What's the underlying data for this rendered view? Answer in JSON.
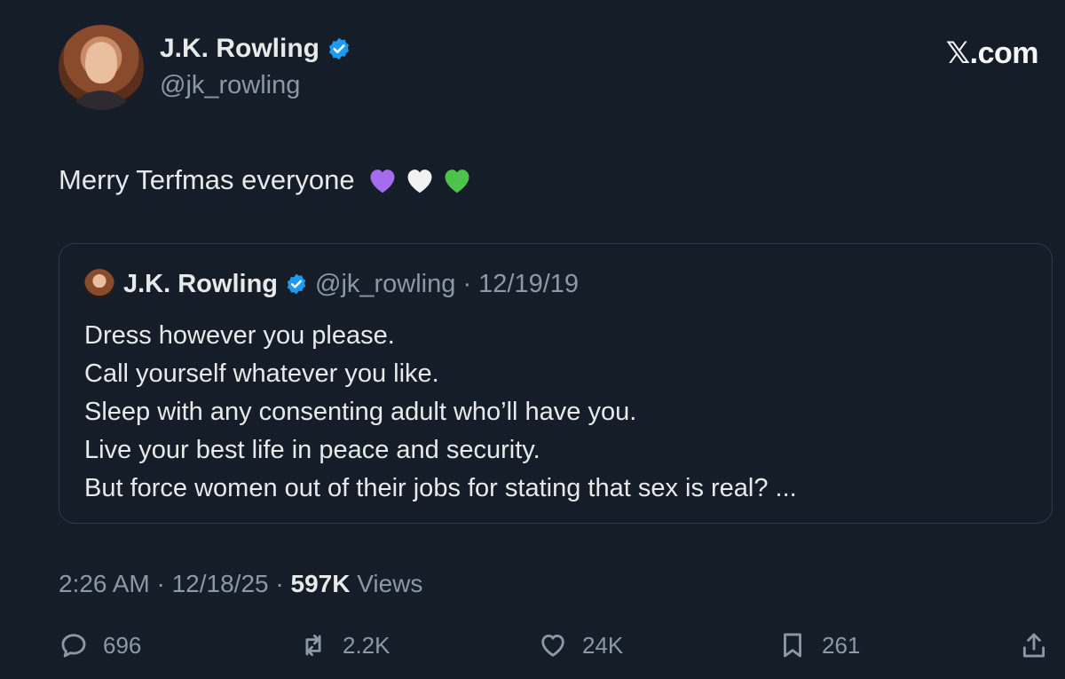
{
  "header": {
    "display_name": "J.K. Rowling",
    "handle": "@jk_rowling",
    "brand": "𝕏.com"
  },
  "tweet": {
    "text": "Merry Terfmas everyone",
    "emojis": [
      "purple-heart",
      "white-heart",
      "green-heart"
    ],
    "timestamp": "2:26 AM · 12/18/25 · ",
    "views_count": "597K",
    "views_label": " Views"
  },
  "quoted": {
    "display_name": "J.K. Rowling",
    "meta": "@jk_rowling · 12/19/19",
    "lines": [
      "Dress however you please.",
      "Call yourself whatever you like.",
      "Sleep with any consenting adult who’ll have you.",
      "Live your best life in peace and security.",
      "But force women out of their jobs for stating that sex is real? ..."
    ]
  },
  "actions": {
    "replies": "696",
    "reposts": "2.2K",
    "likes": "24K",
    "bookmarks": "261"
  },
  "colors": {
    "background": "#151d28",
    "verified_blue": "#1d9bf0",
    "muted_text": "#8b98a5"
  }
}
